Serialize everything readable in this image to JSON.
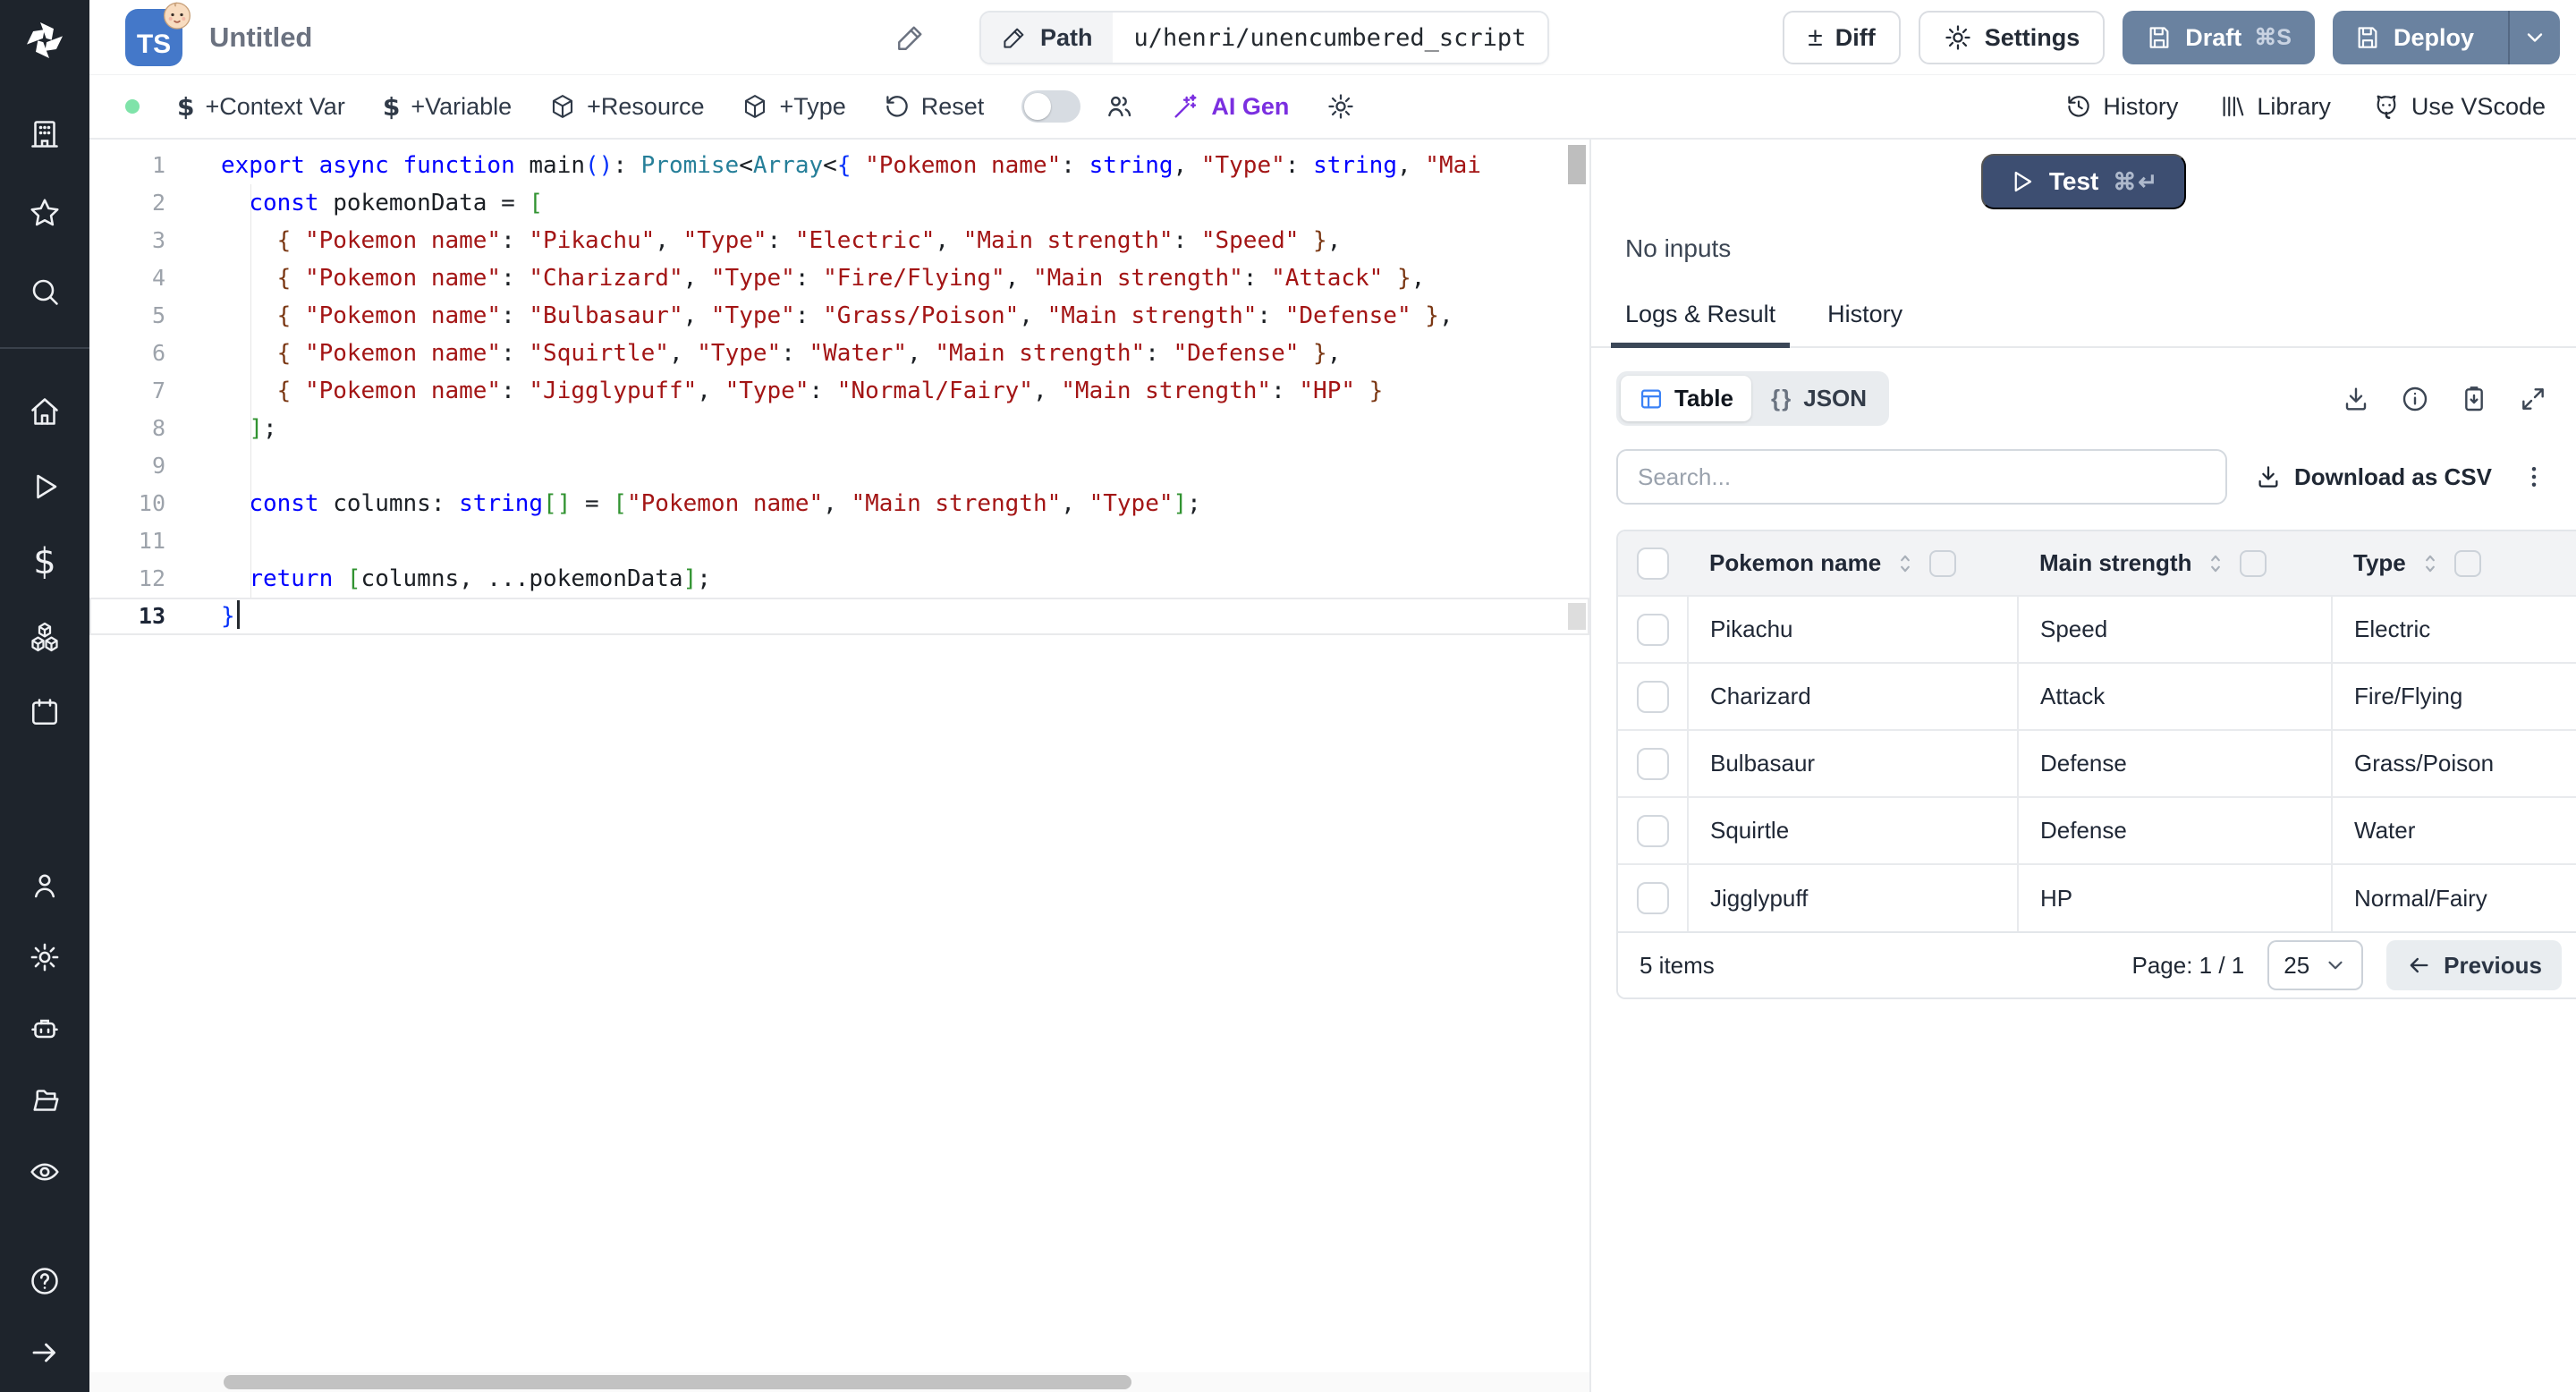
{
  "icons": {
    "dollar": "$",
    "diff": "±",
    "braces": "{}"
  },
  "topbar": {
    "badge": "TS",
    "title": "Untitled",
    "path_label": "Path",
    "path_value": "u/henri/unencumbered_script",
    "diff_label": "Diff",
    "settings_label": "Settings",
    "draft_label": "Draft",
    "draft_shortcut": "⌘S",
    "deploy_label": "Deploy"
  },
  "toolbar": {
    "context_var": "+Context Var",
    "variable": "+Variable",
    "resource": "+Resource",
    "type": "+Type",
    "reset": "Reset",
    "ai_gen": "AI Gen",
    "history": "History",
    "library": "Library",
    "vscode": "Use VScode"
  },
  "editor": {
    "lines": [
      {
        "segs": [
          [
            "kw",
            "export async function"
          ],
          [
            "pl",
            " main"
          ],
          [
            "brF",
            "()"
          ],
          [
            "pl",
            ": "
          ],
          [
            "ty",
            "Promise"
          ],
          [
            "pl",
            "<"
          ],
          [
            "ty",
            "Array"
          ],
          [
            "pl",
            "<"
          ],
          [
            "brF",
            "{ "
          ],
          [
            "st",
            "\"Pokemon name\""
          ],
          [
            "pl",
            ": "
          ],
          [
            "kw",
            "string"
          ],
          [
            "pl",
            ", "
          ],
          [
            "st",
            "\"Type\""
          ],
          [
            "pl",
            ": "
          ],
          [
            "kw",
            "string"
          ],
          [
            "pl",
            ", "
          ],
          [
            "st",
            "\"Mai"
          ]
        ]
      },
      {
        "segs": [
          [
            "pl",
            "  "
          ],
          [
            "kw",
            "const"
          ],
          [
            "pl",
            " pokemonData = "
          ],
          [
            "brG",
            "["
          ]
        ]
      },
      {
        "segs": [
          [
            "pl",
            "    "
          ],
          [
            "brB",
            "{ "
          ],
          [
            "st",
            "\"Pokemon name\""
          ],
          [
            "pl",
            ": "
          ],
          [
            "st",
            "\"Pikachu\""
          ],
          [
            "pl",
            ", "
          ],
          [
            "st",
            "\"Type\""
          ],
          [
            "pl",
            ": "
          ],
          [
            "st",
            "\"Electric\""
          ],
          [
            "pl",
            ", "
          ],
          [
            "st",
            "\"Main strength\""
          ],
          [
            "pl",
            ": "
          ],
          [
            "st",
            "\"Speed\""
          ],
          [
            "brB",
            " }"
          ],
          [
            "pl",
            ","
          ]
        ]
      },
      {
        "segs": [
          [
            "pl",
            "    "
          ],
          [
            "brB",
            "{ "
          ],
          [
            "st",
            "\"Pokemon name\""
          ],
          [
            "pl",
            ": "
          ],
          [
            "st",
            "\"Charizard\""
          ],
          [
            "pl",
            ", "
          ],
          [
            "st",
            "\"Type\""
          ],
          [
            "pl",
            ": "
          ],
          [
            "st",
            "\"Fire/Flying\""
          ],
          [
            "pl",
            ", "
          ],
          [
            "st",
            "\"Main strength\""
          ],
          [
            "pl",
            ": "
          ],
          [
            "st",
            "\"Attack\""
          ],
          [
            "brB",
            " }"
          ],
          [
            "pl",
            ","
          ]
        ]
      },
      {
        "segs": [
          [
            "pl",
            "    "
          ],
          [
            "brB",
            "{ "
          ],
          [
            "st",
            "\"Pokemon name\""
          ],
          [
            "pl",
            ": "
          ],
          [
            "st",
            "\"Bulbasaur\""
          ],
          [
            "pl",
            ", "
          ],
          [
            "st",
            "\"Type\""
          ],
          [
            "pl",
            ": "
          ],
          [
            "st",
            "\"Grass/Poison\""
          ],
          [
            "pl",
            ", "
          ],
          [
            "st",
            "\"Main strength\""
          ],
          [
            "pl",
            ": "
          ],
          [
            "st",
            "\"Defense\""
          ],
          [
            "brB",
            " }"
          ],
          [
            "pl",
            ","
          ]
        ]
      },
      {
        "segs": [
          [
            "pl",
            "    "
          ],
          [
            "brB",
            "{ "
          ],
          [
            "st",
            "\"Pokemon name\""
          ],
          [
            "pl",
            ": "
          ],
          [
            "st",
            "\"Squirtle\""
          ],
          [
            "pl",
            ", "
          ],
          [
            "st",
            "\"Type\""
          ],
          [
            "pl",
            ": "
          ],
          [
            "st",
            "\"Water\""
          ],
          [
            "pl",
            ", "
          ],
          [
            "st",
            "\"Main strength\""
          ],
          [
            "pl",
            ": "
          ],
          [
            "st",
            "\"Defense\""
          ],
          [
            "brB",
            " }"
          ],
          [
            "pl",
            ","
          ]
        ]
      },
      {
        "segs": [
          [
            "pl",
            "    "
          ],
          [
            "brB",
            "{ "
          ],
          [
            "st",
            "\"Pokemon name\""
          ],
          [
            "pl",
            ": "
          ],
          [
            "st",
            "\"Jigglypuff\""
          ],
          [
            "pl",
            ", "
          ],
          [
            "st",
            "\"Type\""
          ],
          [
            "pl",
            ": "
          ],
          [
            "st",
            "\"Normal/Fairy\""
          ],
          [
            "pl",
            ", "
          ],
          [
            "st",
            "\"Main strength\""
          ],
          [
            "pl",
            ": "
          ],
          [
            "st",
            "\"HP\""
          ],
          [
            "brB",
            " }"
          ]
        ]
      },
      {
        "segs": [
          [
            "pl",
            "  "
          ],
          [
            "brG",
            "]"
          ],
          [
            "pl",
            ";"
          ]
        ]
      },
      {
        "segs": []
      },
      {
        "segs": [
          [
            "pl",
            "  "
          ],
          [
            "kw",
            "const"
          ],
          [
            "pl",
            " columns: "
          ],
          [
            "kw",
            "string"
          ],
          [
            "brG",
            "[]"
          ],
          [
            "pl",
            " = "
          ],
          [
            "brG",
            "["
          ],
          [
            "st",
            "\"Pokemon name\""
          ],
          [
            "pl",
            ", "
          ],
          [
            "st",
            "\"Main strength\""
          ],
          [
            "pl",
            ", "
          ],
          [
            "st",
            "\"Type\""
          ],
          [
            "brG",
            "]"
          ],
          [
            "pl",
            ";"
          ]
        ]
      },
      {
        "segs": []
      },
      {
        "segs": [
          [
            "pl",
            "  "
          ],
          [
            "kw",
            "return"
          ],
          [
            "pl",
            " "
          ],
          [
            "brG",
            "["
          ],
          [
            "pl",
            "columns, ...pokemonData"
          ],
          [
            "brG",
            "]"
          ],
          [
            "pl",
            ";"
          ]
        ]
      },
      {
        "active": true,
        "segs": [
          [
            "brF",
            "}"
          ]
        ]
      }
    ]
  },
  "panel": {
    "test_label": "Test",
    "test_shortcut": "⌘↵",
    "no_inputs": "No inputs",
    "tab_logs": "Logs & Result",
    "tab_history": "History",
    "seg_table": "Table",
    "seg_json": "JSON",
    "search_placeholder": "Search...",
    "download_csv": "Download as CSV",
    "table": {
      "columns": [
        "Pokemon name",
        "Main strength",
        "Type"
      ],
      "rows": [
        [
          "Pikachu",
          "Speed",
          "Electric"
        ],
        [
          "Charizard",
          "Attack",
          "Fire/Flying"
        ],
        [
          "Bulbasaur",
          "Defense",
          "Grass/Poison"
        ],
        [
          "Squirtle",
          "Defense",
          "Water"
        ],
        [
          "Jigglypuff",
          "HP",
          "Normal/Fairy"
        ]
      ]
    },
    "footer": {
      "count": "5 items",
      "page": "Page: 1 / 1",
      "page_size": "25",
      "previous": "Previous"
    }
  },
  "colors": {
    "sidebar_bg": "#1e242c",
    "primary_button": "#6a82a0",
    "test_button": "#3d4e71",
    "ai_gen": "#7b2fe0",
    "ts_badge": "#4478c9",
    "green_status_dot": "#7fe3a9",
    "table_icon_blue": "#3b82f6",
    "code_keyword": "#0000ff",
    "code_type": "#267f99",
    "code_string": "#a31515"
  }
}
